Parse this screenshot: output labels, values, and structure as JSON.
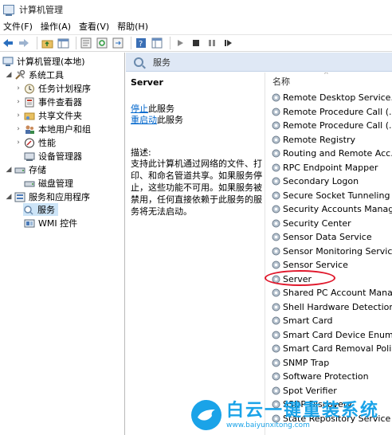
{
  "window": {
    "title": "计算机管理"
  },
  "menu": [
    "文件(F)",
    "操作(A)",
    "查看(V)",
    "帮助(H)"
  ],
  "toolbar": [
    "back-arrow-icon",
    "forward-arrow-icon",
    "up-folder-icon",
    "show-tree-icon",
    "properties-icon",
    "refresh-icon",
    "export-icon",
    "help-icon",
    "console-icon",
    "play-icon",
    "stop-icon",
    "pause-icon",
    "restart-icon"
  ],
  "tree": {
    "root": "计算机管理(本地)",
    "system_tools": "系统工具",
    "task_scheduler": "任务计划程序",
    "event_viewer": "事件查看器",
    "shared_folders": "共享文件夹",
    "local_users": "本地用户和组",
    "performance": "性能",
    "device_manager": "设备管理器",
    "storage": "存储",
    "disk_management": "磁盘管理",
    "services_apps": "服务和应用程序",
    "services": "服务",
    "wmi": "WMI 控件"
  },
  "services_header": "服务",
  "detail": {
    "service_name": "Server",
    "stop_link": "停止",
    "stop_rest": "此服务",
    "restart_link": "重启动",
    "restart_rest": "此服务",
    "desc_title": "描述:",
    "description": "支持此计算机通过网络的文件、打印、和命名管道共享。如果服务停止，这些功能不可用。如果服务被禁用，任何直接依赖于此服务的服务将无法启动。"
  },
  "list": {
    "column": "名称",
    "items": [
      "Remote Desktop Service...",
      "Remote Procedure Call (...",
      "Remote Procedure Call (...",
      "Remote Registry",
      "Routing and Remote Acc...",
      "RPC Endpoint Mapper",
      "Secondary Logon",
      "Secure Socket Tunneling ...",
      "Security Accounts Manag...",
      "Security Center",
      "Sensor Data Service",
      "Sensor Monitoring Service",
      "Sensor Service",
      "Server",
      "Shared PC Account Mana...",
      "Shell Hardware Detection",
      "Smart Card",
      "Smart Card Device Enum...",
      "Smart Card Removal Poli...",
      "SNMP Trap",
      "Software Protection",
      "Spot Verifier",
      "SSDP Discovery",
      "State Repository Service"
    ]
  },
  "watermark": {
    "title": "白云一键重装系统",
    "url": "www.baiyunxitong.com"
  },
  "colors": {
    "header_bg": "#dfe8f5",
    "link": "#0066cc",
    "highlight": "#e0182c",
    "watermark": "#1aa3e8"
  }
}
